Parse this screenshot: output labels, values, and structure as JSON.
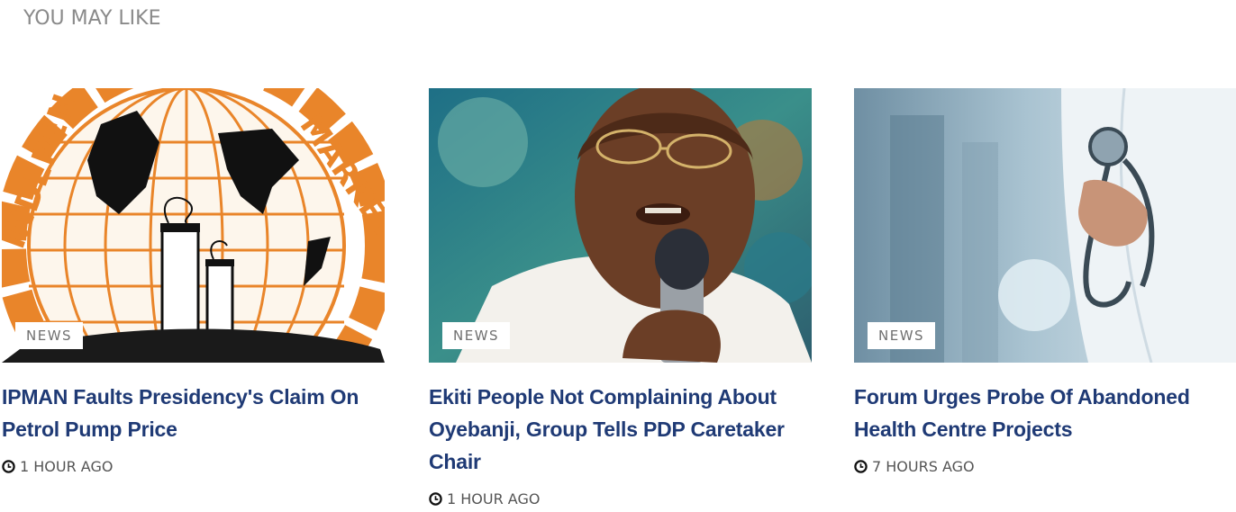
{
  "section": {
    "title": "YOU MAY LIKE"
  },
  "articles": [
    {
      "category": "NEWS",
      "title": "IPMAN Faults Presidency's Claim On Petrol Pump Price",
      "time": "1 HOUR AGO"
    },
    {
      "category": "NEWS",
      "title": "Ekiti People Not Complaining About Oyebanji, Group Tells PDP Caretaker Chair",
      "time": "1 HOUR AGO"
    },
    {
      "category": "NEWS",
      "title": "Forum Urges Probe Of Abandoned Health Centre Projects",
      "time": "7 HOURS AGO"
    }
  ],
  "icons": {
    "time": "clock-icon"
  },
  "colors": {
    "headline": "#1f3a75",
    "section_title": "#8a8a8a",
    "badge_text": "#707070"
  }
}
